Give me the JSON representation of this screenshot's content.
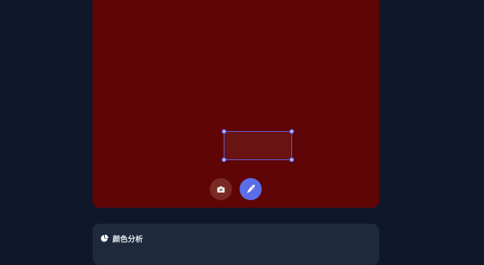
{
  "camera": {
    "frame_color": "#600505",
    "accent": "#6366f1"
  },
  "controls": {
    "camera_switch_icon": "camera-rotate-icon",
    "eyedropper_icon": "eyedropper-icon"
  },
  "panel": {
    "title": "颜色分析",
    "icon": "pie-chart-icon"
  }
}
